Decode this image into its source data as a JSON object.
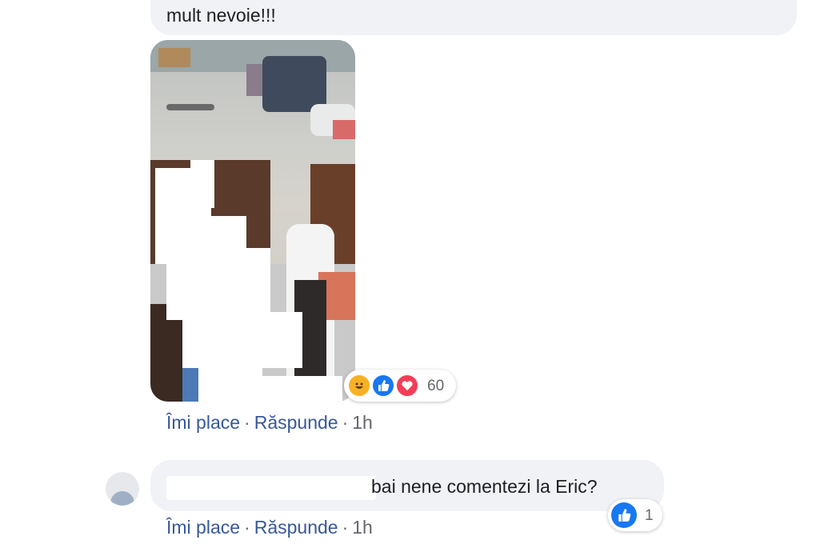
{
  "comment1": {
    "text": "mult nevoie!!!",
    "reaction_count": "60",
    "reaction_icons": [
      "haha-icon",
      "like-icon",
      "love-icon"
    ],
    "actions": {
      "like": "Îmi place",
      "reply": "Răspunde",
      "time": "1h"
    }
  },
  "comment2": {
    "text": "bai nene comentezi la Eric?",
    "reaction_count": "1",
    "reaction_icons": [
      "like-icon"
    ],
    "actions": {
      "like": "Îmi place",
      "reply": "Răspunde",
      "time": "1h"
    }
  },
  "colors": {
    "bubble": "#f0f2f5",
    "link": "#385898",
    "meta": "#65676b",
    "like": "#1877f2",
    "love": "#f33e58",
    "haha": "#f7b125"
  }
}
